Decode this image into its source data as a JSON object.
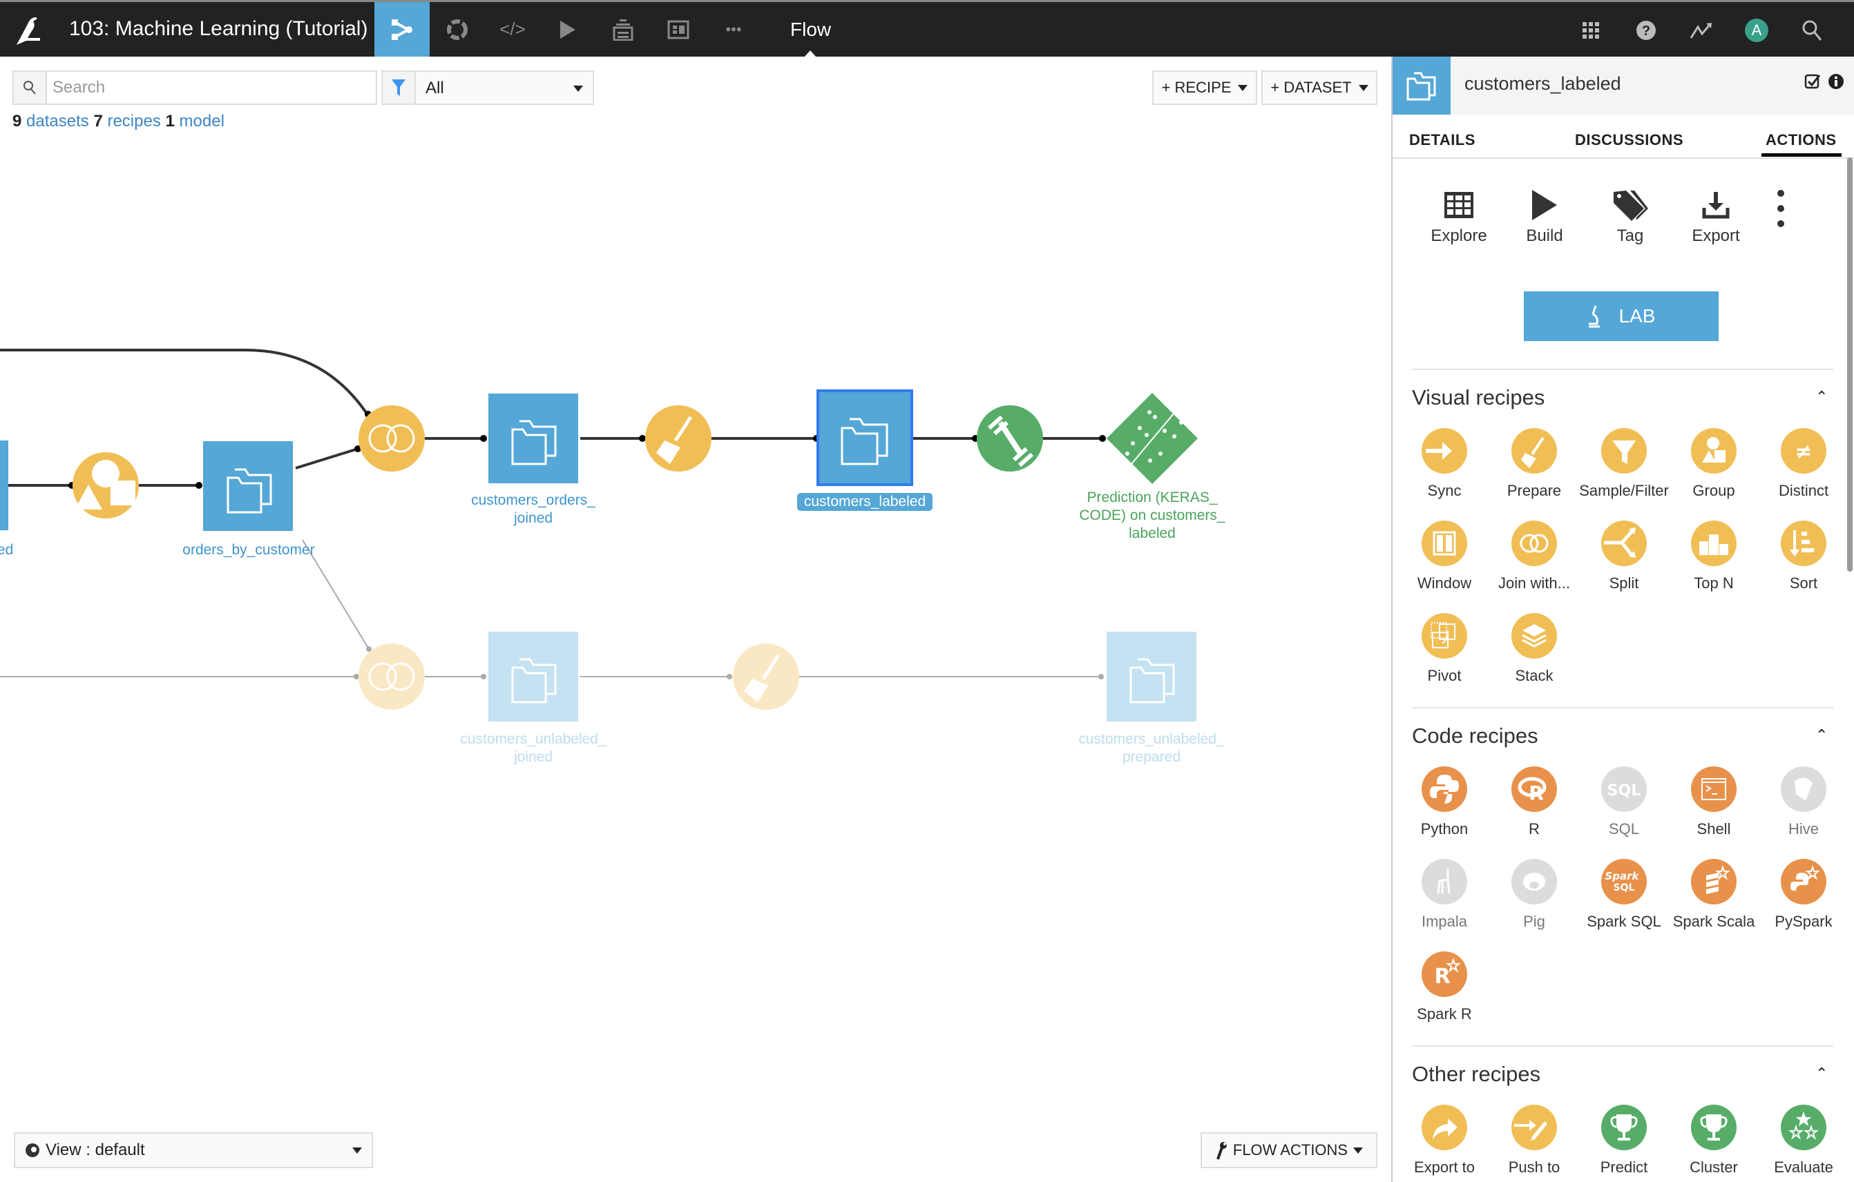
{
  "topbar": {
    "project_title": "103: Machine Learning (Tutorial)",
    "current_view": "Flow",
    "nav_icons": [
      "flow-icon",
      "analysis-icon",
      "code-icon",
      "jobs-icon",
      "dashboards-icon",
      "wiki-icon",
      "more-icon"
    ],
    "right_icons": [
      "apps-grid-icon",
      "help-icon",
      "activity-icon",
      "avatar",
      "search-icon"
    ],
    "avatar_initial": "A"
  },
  "toolbar": {
    "search_placeholder": "Search",
    "search_value": "",
    "filter_value": "All",
    "add_recipe": "+ RECIPE",
    "add_dataset": "+ DATASET"
  },
  "counts": {
    "datasets_count": "9",
    "datasets_label": "datasets",
    "recipes_count": "7",
    "recipes_label": "recipes",
    "models_count": "1",
    "models_label": "model"
  },
  "flow": {
    "nodes": {
      "partial_dataset_label": "ed",
      "orders_by_customer": "orders_by_customer",
      "customers_orders_joined_1": "customers_orders_",
      "customers_orders_joined_2": "joined",
      "customers_labeled": "customers_labeled",
      "prediction_1": "Prediction (KERAS_",
      "prediction_2": "CODE) on customers_",
      "prediction_3": "labeled",
      "customers_unlabeled_joined_1": "customers_unlabeled_",
      "customers_unlabeled_joined_2": "joined",
      "customers_unlabeled_prepared_1": "customers_unlabeled_",
      "customers_unlabeled_prepared_2": "prepared"
    },
    "colors": {
      "dataset": "#54a7d6",
      "visual_recipe": "#f0be55",
      "ml": "#57ad68",
      "faded_dataset": "#c4e2f1",
      "faded_recipe": "#fae8c4"
    }
  },
  "bottom": {
    "view_select": "View : default",
    "flow_actions": "FLOW ACTIONS"
  },
  "panel": {
    "title": "customers_labeled",
    "tabs": [
      "DETAILS",
      "DISCUSSIONS",
      "ACTIONS"
    ],
    "active_tab": "ACTIONS",
    "actions": [
      {
        "label": "Explore",
        "icon": "table-icon"
      },
      {
        "label": "Build",
        "icon": "play-icon"
      },
      {
        "label": "Tag",
        "icon": "tag-icon"
      },
      {
        "label": "Export",
        "icon": "download-icon"
      }
    ],
    "lab_label": "LAB",
    "sections": [
      {
        "title": "Visual recipes",
        "items": [
          {
            "label": "Sync",
            "icon": "sync-icon",
            "color": "#f0be55"
          },
          {
            "label": "Prepare",
            "icon": "broom-icon",
            "color": "#f0be55"
          },
          {
            "label": "Sample/Filter",
            "icon": "funnel-icon",
            "color": "#f0be55"
          },
          {
            "label": "Group",
            "icon": "group-shapes-icon",
            "color": "#f0be55"
          },
          {
            "label": "Distinct",
            "icon": "not-equal-icon",
            "color": "#f0be55"
          },
          {
            "label": "Window",
            "icon": "window-icon",
            "color": "#f0be55"
          },
          {
            "label": "Join with...",
            "icon": "join-icon",
            "color": "#f0be55"
          },
          {
            "label": "Split",
            "icon": "split-icon",
            "color": "#f0be55"
          },
          {
            "label": "Top N",
            "icon": "podium-icon",
            "color": "#f0be55"
          },
          {
            "label": "Sort",
            "icon": "sort-icon",
            "color": "#f0be55"
          },
          {
            "label": "Pivot",
            "icon": "pivot-icon",
            "color": "#f0be55"
          },
          {
            "label": "Stack",
            "icon": "stack-icon",
            "color": "#f0be55"
          }
        ]
      },
      {
        "title": "Code recipes",
        "items": [
          {
            "label": "Python",
            "icon": "python-icon",
            "color": "#e8914a"
          },
          {
            "label": "R",
            "icon": "r-icon",
            "color": "#e8914a"
          },
          {
            "label": "SQL",
            "icon": "sql-icon",
            "color": "#dcdcdc",
            "disabled": true
          },
          {
            "label": "Shell",
            "icon": "terminal-icon",
            "color": "#e8914a"
          },
          {
            "label": "Hive",
            "icon": "hive-icon",
            "color": "#dcdcdc",
            "disabled": true
          },
          {
            "label": "Impala",
            "icon": "impala-icon",
            "color": "#dcdcdc",
            "disabled": true
          },
          {
            "label": "Pig",
            "icon": "pig-icon",
            "color": "#dcdcdc",
            "disabled": true
          },
          {
            "label": "Spark SQL",
            "icon": "spark-sql-icon",
            "color": "#e8914a"
          },
          {
            "label": "Spark Scala",
            "icon": "spark-scala-icon",
            "color": "#e8914a"
          },
          {
            "label": "PySpark",
            "icon": "pyspark-icon",
            "color": "#e8914a"
          },
          {
            "label": "Spark R",
            "icon": "spark-r-icon",
            "color": "#e8914a"
          }
        ]
      },
      {
        "title": "Other recipes",
        "items": [
          {
            "label": "Export to",
            "icon": "share-arrow-icon",
            "color": "#f0be55"
          },
          {
            "label": "Push to",
            "icon": "push-pencil-icon",
            "color": "#f0be55"
          },
          {
            "label": "Predict",
            "icon": "trophy-icon",
            "color": "#57ad68"
          },
          {
            "label": "Cluster",
            "icon": "trophy-icon",
            "color": "#57ad68"
          },
          {
            "label": "Evaluate",
            "icon": "stars-icon",
            "color": "#57ad68"
          }
        ]
      }
    ]
  }
}
